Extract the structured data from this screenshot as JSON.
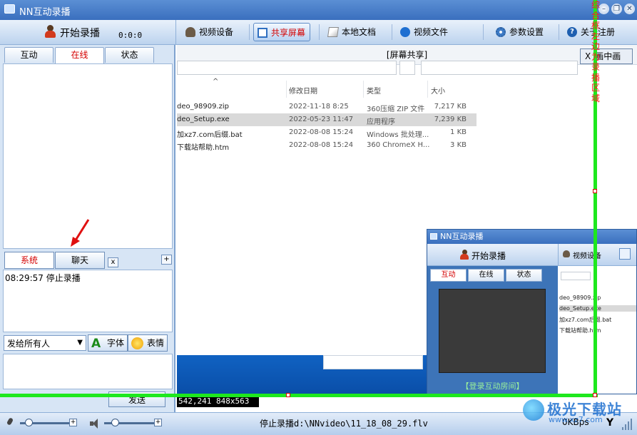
{
  "window": {
    "title": "NN互动录播",
    "minimize_glyph": "–",
    "restore_glyph": "❐",
    "close_glyph": "✕"
  },
  "record": {
    "label": "开始录播",
    "timer": "0:0:0"
  },
  "toolbar": {
    "items": [
      {
        "label": "视频设备",
        "icon": "user-icon"
      },
      {
        "label": "共享屏幕",
        "icon": "screen-icon",
        "active": true
      },
      {
        "label": "本地文档",
        "icon": "document-icon"
      },
      {
        "label": "视频文件",
        "icon": "play-icon"
      },
      {
        "label": "参数设置",
        "icon": "gear-icon"
      },
      {
        "label": "关于注册",
        "icon": "help-icon"
      }
    ]
  },
  "left_tabs": [
    {
      "label": "互动"
    },
    {
      "label": "在线",
      "active": true
    },
    {
      "label": "状态"
    }
  ],
  "chat": {
    "tabs": [
      {
        "label": "系统",
        "active": true
      },
      {
        "label": "聊天"
      }
    ],
    "close_label": "x",
    "add_label": "+",
    "log": "08:29:57 停止录播",
    "send_to": "发给所有人",
    "font_glyph": "A",
    "font_label": "字体",
    "emoji_label": "表情",
    "send_label": "发送"
  },
  "main": {
    "header": "[屏幕共享]",
    "close_x": "X",
    "mode_label": "画中画",
    "columns": [
      "修改日期",
      "类型",
      "大小"
    ],
    "sort_glyph": "^",
    "files": [
      {
        "name": "deo_98909.zip",
        "date": "2022-11-18 8:25",
        "type": "360压缩 ZIP 文件",
        "size": "7,217 KB",
        "selected": false
      },
      {
        "name": "deo_Setup.exe",
        "date": "2022-05-23 11:47",
        "type": "应用程序",
        "size": "7,239 KB",
        "selected": true
      },
      {
        "name": "加xz7.com后缀.bat",
        "date": "2022-08-08 15:24",
        "type": "Windows 批处理...",
        "size": "1 KB",
        "selected": false
      },
      {
        "name": "下载站帮助.htm",
        "date": "2022-08-08 15:24",
        "type": "360 ChromeX H...",
        "size": "3 KB",
        "selected": false
      }
    ],
    "coords": "542,241 848x563",
    "capture_label": "综合框左边为录播区域"
  },
  "mini_window": {
    "title": "NN互动录播",
    "record_label": "开始录播",
    "toolbar_item": "视频设备",
    "tabs": [
      {
        "label": "互动",
        "active": true
      },
      {
        "label": "在线"
      },
      {
        "label": "状态"
      }
    ],
    "login_label": "【登录互动房间】",
    "files": [
      {
        "name": "deo_98909.zip",
        "selected": false
      },
      {
        "name": "deo_Setup.exe",
        "selected": true
      },
      {
        "name": "加xz7.com后缀.bat",
        "selected": false
      },
      {
        "name": "下载站帮助.htm",
        "selected": false
      }
    ]
  },
  "statusbar": {
    "mic_level": 0.1,
    "speaker_level": 0.15,
    "status": "停止录播d:\\NNvideo\\11_18_08_29.flv",
    "bitrate": "0KBps",
    "antenna_glyph": "Y"
  },
  "watermark": {
    "text": "极光下载站",
    "url": "www.xz7.com"
  },
  "colors": {
    "titlebar": "#3a6fbe",
    "capture_frame": "#1ee81e",
    "active_tab_text": "#d40000"
  }
}
